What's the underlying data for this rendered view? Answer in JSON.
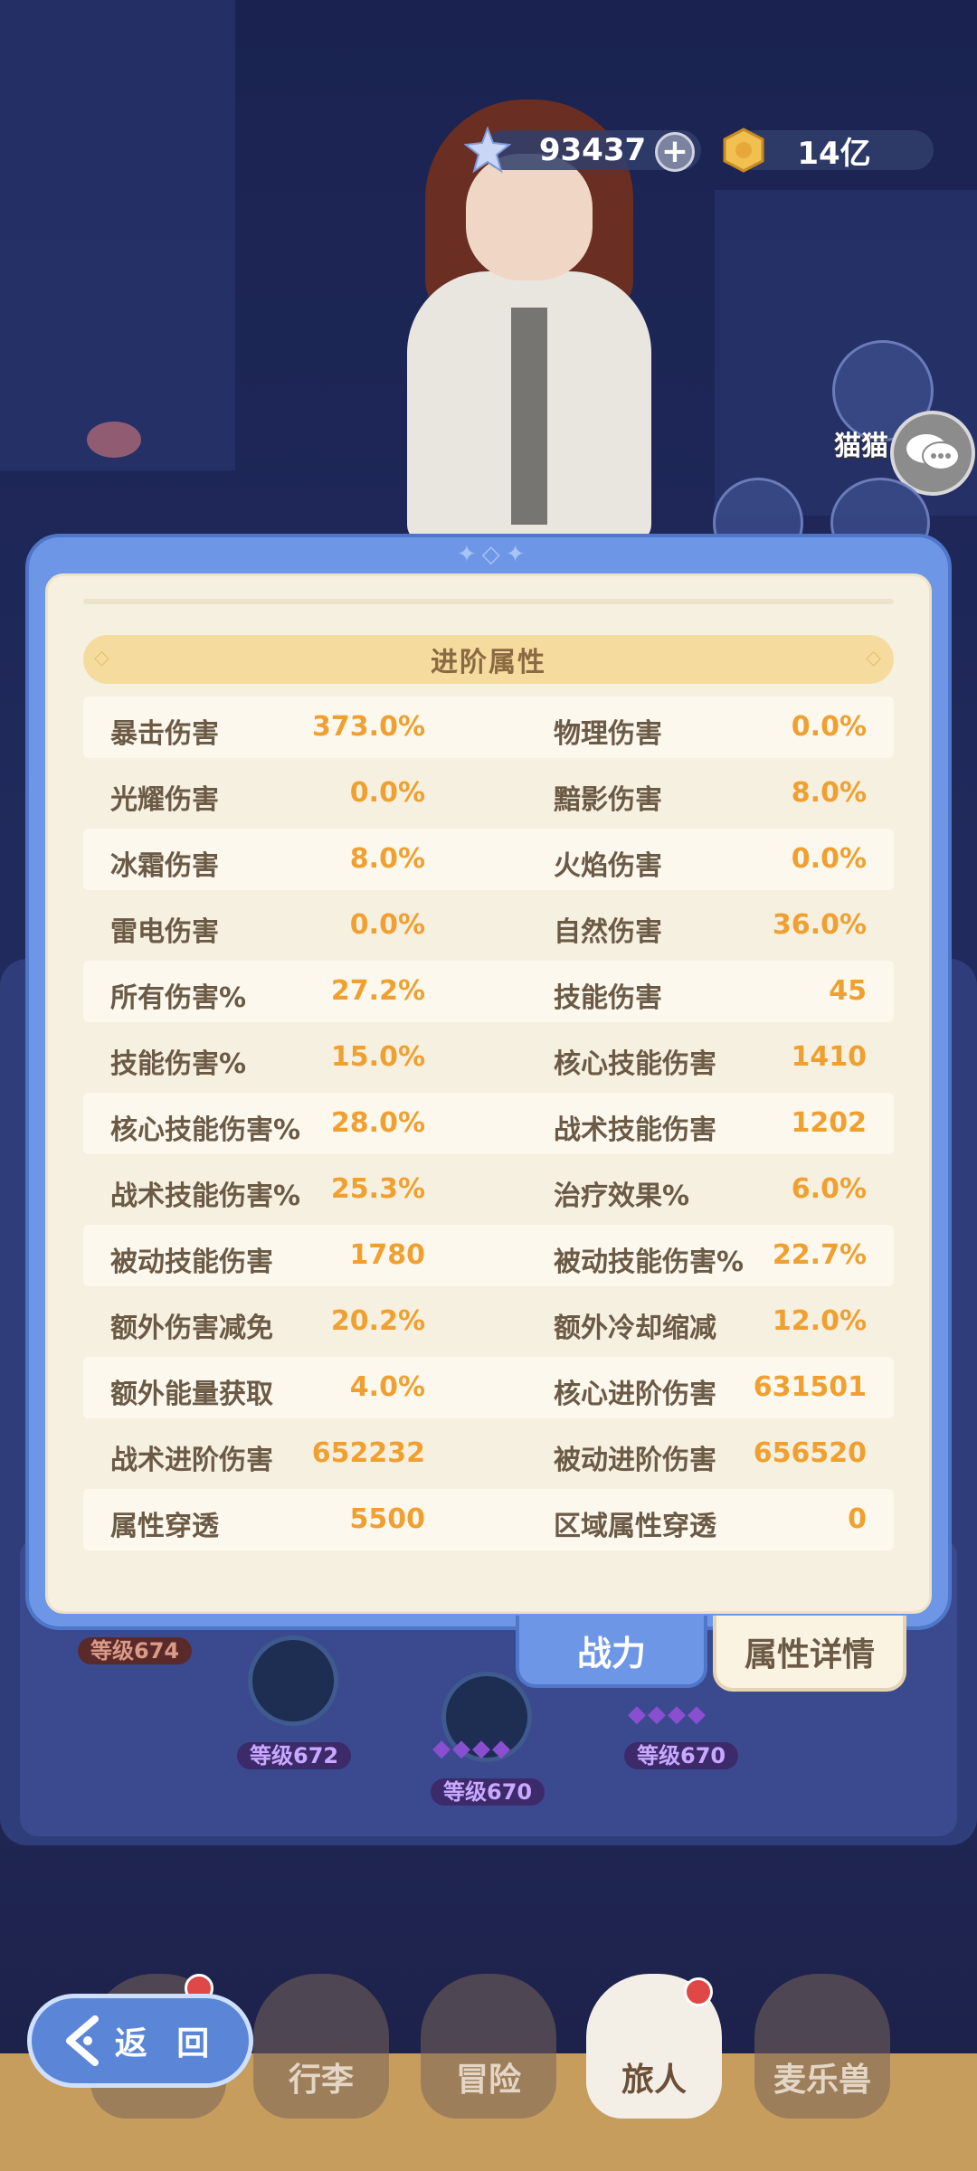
{
  "currency": {
    "crystal": "93437",
    "coin": "14亿"
  },
  "side_label": "猫猫",
  "dialog": {
    "section_title": "进阶属性",
    "rows": [
      {
        "left_label": "暴击伤害",
        "left_value": "373.0%",
        "right_label": "物理伤害",
        "right_value": "0.0%"
      },
      {
        "left_label": "光耀伤害",
        "left_value": "0.0%",
        "right_label": "黯影伤害",
        "right_value": "8.0%"
      },
      {
        "left_label": "冰霜伤害",
        "left_value": "8.0%",
        "right_label": "火焰伤害",
        "right_value": "0.0%"
      },
      {
        "left_label": "雷电伤害",
        "left_value": "0.0%",
        "right_label": "自然伤害",
        "right_value": "36.0%"
      },
      {
        "left_label": "所有伤害%",
        "left_value": "27.2%",
        "right_label": "技能伤害",
        "right_value": "45"
      },
      {
        "left_label": "技能伤害%",
        "left_value": "15.0%",
        "right_label": "核心技能伤害",
        "right_value": "1410"
      },
      {
        "left_label": "核心技能伤害%",
        "left_value": "28.0%",
        "right_label": "战术技能伤害",
        "right_value": "1202"
      },
      {
        "left_label": "战术技能伤害%",
        "left_value": "25.3%",
        "right_label": "治疗效果%",
        "right_value": "6.0%"
      },
      {
        "left_label": "被动技能伤害",
        "left_value": "1780",
        "right_label": "被动技能伤害%",
        "right_value": "22.7%"
      },
      {
        "left_label": "额外伤害减免",
        "left_value": "20.2%",
        "right_label": "额外冷却缩减",
        "right_value": "12.0%"
      },
      {
        "left_label": "额外能量获取",
        "left_value": "4.0%",
        "right_label": "核心进阶伤害",
        "right_value": "631501"
      },
      {
        "left_label": "战术进阶伤害",
        "left_value": "652232",
        "right_label": "被动进阶伤害",
        "right_value": "656520"
      },
      {
        "left_label": "属性穿透",
        "left_value": "5500",
        "right_label": "区域属性穿透",
        "right_value": "0"
      }
    ]
  },
  "tabs": {
    "power": "战力",
    "detail": "属性详情"
  },
  "levels": {
    "l1": "等级674",
    "l2": "等级672",
    "l3": "等级670",
    "l4": "等级670"
  },
  "nav": {
    "back": "返 回",
    "luggage": "行李",
    "adventure": "冒险",
    "traveler": "旅人",
    "pet": "麦乐兽"
  },
  "colors": {
    "accent_value": "#f0a030",
    "frame_blue": "#6e96e6",
    "panel_cream": "#f6f0e0"
  }
}
